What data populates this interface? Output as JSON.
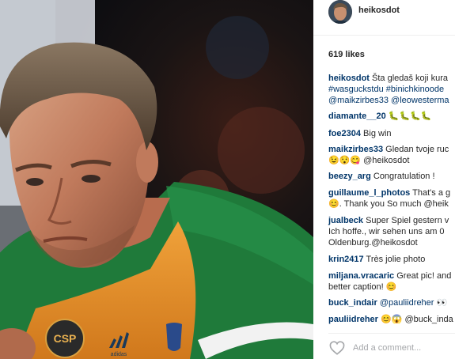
{
  "post": {
    "image_alt": "photo of a man wearing an orange and green jersey",
    "jersey_badge_text": "CSP",
    "jersey_brand": "adidas"
  },
  "header": {
    "username": "heikosdot"
  },
  "likes": "619 likes",
  "comments": [
    {
      "user": "heikosdot",
      "lines": [
        "Šta gledaš koji kura",
        "#wasguckstdu #binichkinoode",
        "@maikzirbes33 @leowesterma"
      ]
    },
    {
      "user": "diamante__20",
      "lines": [
        "🐛🐛🐛🐛"
      ]
    },
    {
      "user": "foe2304",
      "lines": [
        "Big win"
      ]
    },
    {
      "user": "maikzirbes33",
      "lines": [
        "Gledan tvoje ruc",
        "😉😯😋 @heikosdot"
      ]
    },
    {
      "user": "beezy_arg",
      "lines": [
        "Congratulation !"
      ]
    },
    {
      "user": "guillaume_l_photos",
      "lines": [
        "That's a g",
        "😊. Thank you So much @heik"
      ]
    },
    {
      "user": "jualbeck",
      "lines": [
        "Super Spiel gestern v",
        "Ich hoffe., wir sehen uns am 0",
        "Oldenburg.@heikosdot"
      ]
    },
    {
      "user": "krin2417",
      "lines": [
        "Très jolie photo"
      ]
    },
    {
      "user": "miljana.vracaric",
      "lines": [
        "Great pic! and",
        "better caption! 😊"
      ]
    },
    {
      "user": "buck_indair",
      "lines": [
        "@pauliidreher 👀"
      ]
    },
    {
      "user": "pauliidreher",
      "lines": [
        "😊😱 @buck_inda"
      ]
    }
  ],
  "add_comment_placeholder": "Add a comment...",
  "icons": {
    "like": "heart-icon"
  },
  "colors": {
    "username": "#003569",
    "text": "#262626",
    "placeholder": "#a5a7aa",
    "jersey_orange": "#e8932b",
    "jersey_green": "#1f7a3a"
  }
}
